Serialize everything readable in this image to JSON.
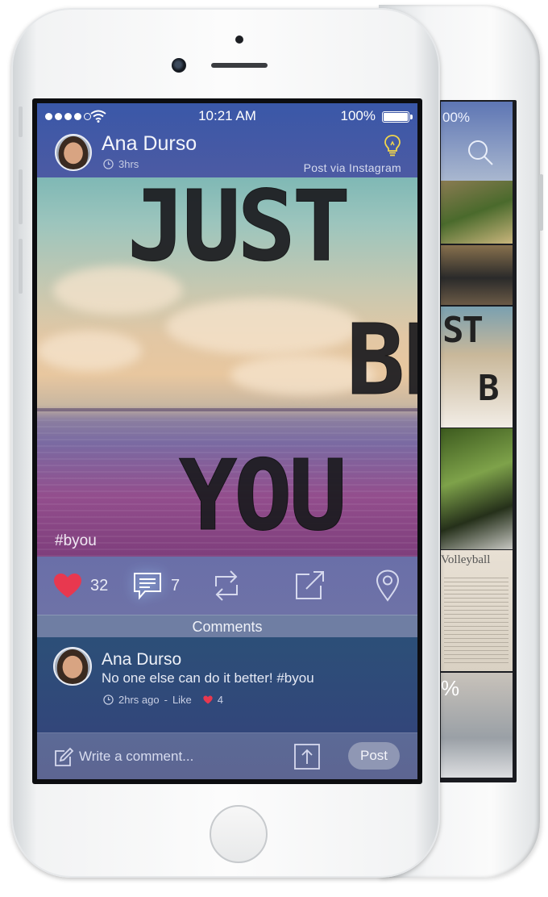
{
  "status_bar": {
    "time": "10:21 AM",
    "battery": "100%"
  },
  "post": {
    "author": "Ana Durso",
    "age": "3hrs",
    "source": "Post via Instagram",
    "image_text": [
      "JUST",
      "BE",
      "YOU"
    ],
    "hashtag": "#byou",
    "likes": "32",
    "comments_count": "7"
  },
  "comments_section": {
    "title": "Comments",
    "items": [
      {
        "author": "Ana Durso",
        "text": "No one else can do it better! #byou",
        "time": "2hrs ago",
        "separator": "-",
        "like_label": "Like",
        "likes": "4"
      }
    ]
  },
  "compose": {
    "placeholder": "Write a comment...",
    "post_label": "Post"
  },
  "back_phone": {
    "battery_partial": "00%",
    "image_text_1": "ST",
    "image_text_2": "B",
    "tile_caption": "Volleyball",
    "percent": "%"
  },
  "colors": {
    "accent_like": "#e8384f",
    "header_blue": "#3a58a8",
    "bulb": "#f2d64b"
  },
  "icons": [
    "wifi-icon",
    "battery-icon",
    "clock-icon",
    "lightbulb-icon",
    "heart-icon",
    "comment-icon",
    "repost-icon",
    "share-icon",
    "location-pin-icon",
    "pencil-icon",
    "upload-icon",
    "search-icon"
  ]
}
